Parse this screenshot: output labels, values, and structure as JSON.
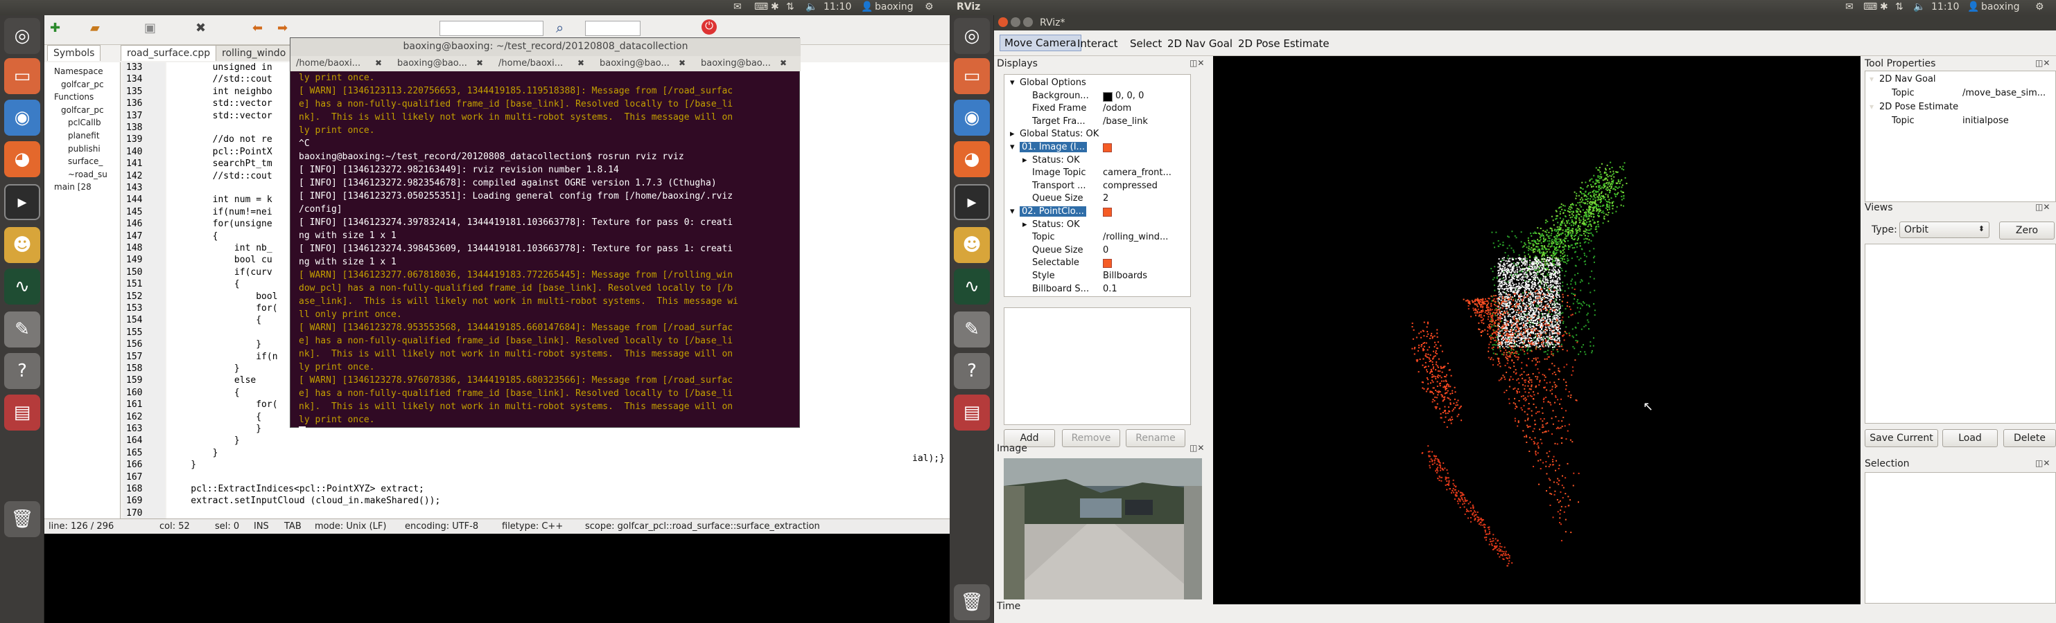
{
  "left_screen": {
    "topbar": {
      "time": "11:10",
      "user": "baoxing"
    },
    "launcher_icons": [
      "ubuntu-icon",
      "folder-icon",
      "chromium-icon",
      "firefox-icon",
      "terminal-icon",
      "game-icon",
      "monitor-icon",
      "editor-icon",
      "help-icon",
      "workspace-icon",
      "trash-icon"
    ],
    "editor": {
      "tabs": [
        "Symbols",
        "road_surface.cpp",
        "rolling_windo"
      ],
      "symbols": [
        "Namespace",
        "golfcar_pc",
        "Functions",
        "golfcar_pc",
        "pclCallb",
        "planefit",
        "publishi",
        "surface_",
        "~road_su",
        "main [28"
      ],
      "line_numbers": [
        "133",
        "134",
        "135",
        "136",
        "137",
        "138",
        "139",
        "140",
        "141",
        "142",
        "143",
        "144",
        "145",
        "146",
        "147",
        "148",
        "149",
        "150",
        "151",
        "152",
        "153",
        "154",
        "155",
        "156",
        "157",
        "158",
        "159",
        "160",
        "161",
        "162",
        "163",
        "164",
        "165",
        "166",
        "167",
        "168",
        "169",
        "170"
      ],
      "code_lines": [
        "        unsigned in",
        "        //std::cout",
        "        int neighbo",
        "        std::vector",
        "        std::vector",
        "",
        "        //do not re",
        "        pcl::PointX",
        "        searchPt_tm",
        "        //std::cout",
        "",
        "        int num = k",
        "        if(num!=nei",
        "        for(unsigne",
        "        {",
        "            int nb_",
        "            bool cu",
        "            if(curv",
        "            {",
        "                bool",
        "                for(",
        "                {",
        "",
        "                }",
        "                if(n",
        "            }",
        "            else",
        "            {",
        "                for(",
        "                {",
        "                }",
        "            }",
        "        }",
        "    }",
        "",
        "    pcl::ExtractIndices<pcl::PointXYZ> extract;",
        "    extract.setInputCloud (cloud_in.makeShared());",
        ""
      ],
      "right_fragment": "ial);}",
      "status": {
        "line": "line: 126 / 296",
        "col": "col: 52",
        "sel": "sel: 0",
        "ins": "INS",
        "tab": "TAB",
        "mode": "mode: Unix (LF)",
        "encoding": "encoding: UTF-8",
        "filetype": "filetype: C++",
        "scope": "scope: golfcar_pcl::road_surface::surface_extraction"
      }
    },
    "terminal": {
      "title": "baoxing@baoxing: ~/test_record/20120808_datacollection",
      "tabs": [
        "/home/baoxi...",
        "baoxing@bao...",
        "/home/baoxi...",
        "baoxing@bao...",
        "baoxing@bao..."
      ],
      "lines": [
        {
          "t": "ly print once.",
          "c": "warn"
        },
        {
          "t": "[ WARN] [1346123113.220756653, 1344419185.119518388]: Message from [/road_surfac",
          "c": "warn"
        },
        {
          "t": "e] has a non-fully-qualified frame_id [base_link]. Resolved locally to [/base_li",
          "c": "warn"
        },
        {
          "t": "nk].  This is will likely not work in multi-robot systems.  This message will on",
          "c": "warn"
        },
        {
          "t": "ly print once.",
          "c": "warn"
        },
        {
          "t": "^C",
          "c": "info"
        },
        {
          "t": "baoxing@baoxing:~/test_record/20120808_datacollection$ rosrun rviz rviz",
          "c": "prompt"
        },
        {
          "t": "[ INFO] [1346123272.982163449]: rviz revision number 1.8.14",
          "c": "info"
        },
        {
          "t": "[ INFO] [1346123272.982354678]: compiled against OGRE version 1.7.3 (Cthugha)",
          "c": "info"
        },
        {
          "t": "[ INFO] [1346123273.050255351]: Loading general config from [/home/baoxing/.rviz",
          "c": "info"
        },
        {
          "t": "/config]",
          "c": "info"
        },
        {
          "t": "[ INFO] [1346123274.397832414, 1344419181.103663778]: Texture for pass 0: creati",
          "c": "info"
        },
        {
          "t": "ng with size 1 x 1",
          "c": "info"
        },
        {
          "t": "[ INFO] [1346123274.398453609, 1344419181.103663778]: Texture for pass 1: creati",
          "c": "info"
        },
        {
          "t": "ng with size 1 x 1",
          "c": "info"
        },
        {
          "t": "[ WARN] [1346123277.067818036, 1344419183.772265445]: Message from [/rolling_win",
          "c": "warn"
        },
        {
          "t": "dow_pcl] has a non-fully-qualified frame_id [base_link]. Resolved locally to [/b",
          "c": "warn"
        },
        {
          "t": "ase_link].  This is will likely not work in multi-robot systems.  This message wi",
          "c": "warn"
        },
        {
          "t": "ll only print once.",
          "c": "warn"
        },
        {
          "t": "[ WARN] [1346123278.953553568, 1344419185.660147684]: Message from [/road_surfac",
          "c": "warn"
        },
        {
          "t": "e] has a non-fully-qualified frame_id [base_link]. Resolved locally to [/base_li",
          "c": "warn"
        },
        {
          "t": "nk].  This is will likely not work in multi-robot systems.  This message will on",
          "c": "warn"
        },
        {
          "t": "ly print once.",
          "c": "warn"
        },
        {
          "t": "[ WARN] [1346123278.976078386, 1344419185.680323566]: Message from [/road_surfac",
          "c": "warn"
        },
        {
          "t": "e] has a non-fully-qualified frame_id [base_link]. Resolved locally to [/base_li",
          "c": "warn"
        },
        {
          "t": "nk].  This is will likely not work in multi-robot systems.  This message will on",
          "c": "warn"
        },
        {
          "t": "ly print once.",
          "c": "warn"
        }
      ]
    }
  },
  "right_screen": {
    "topbar": {
      "app": "RViz",
      "time": "11:10",
      "user": "baoxing"
    },
    "window_title": "RViz*",
    "toolbar": [
      "Move Camera",
      "Interact",
      "Select",
      "2D Nav Goal",
      "2D Pose Estimate"
    ],
    "displays": {
      "header": "Displays",
      "rows": [
        {
          "k": "Global Options",
          "v": "",
          "lvl": 0,
          "arrow": "▾"
        },
        {
          "k": "Backgroun...",
          "v": "0, 0, 0",
          "lvl": 1,
          "sw": true
        },
        {
          "k": "Fixed Frame",
          "v": "/odom",
          "lvl": 1
        },
        {
          "k": "Target Fra...",
          "v": "/base_link",
          "lvl": 1
        },
        {
          "k": "Global Status: OK",
          "v": "",
          "lvl": 0,
          "arrow": "▸"
        },
        {
          "k": "01. Image (I...",
          "v": "",
          "lvl": 0,
          "arrow": "▾",
          "hl": true,
          "chk": true
        },
        {
          "k": "Status: OK",
          "v": "",
          "lvl": 1,
          "arrow": "▸"
        },
        {
          "k": "Image Topic",
          "v": "camera_front...",
          "lvl": 1
        },
        {
          "k": "Transport ...",
          "v": "compressed",
          "lvl": 1
        },
        {
          "k": "Queue Size",
          "v": "2",
          "lvl": 1
        },
        {
          "k": "02. PointClo...",
          "v": "",
          "lvl": 0,
          "arrow": "▾",
          "hl": true,
          "chk": true
        },
        {
          "k": "Status: OK",
          "v": "",
          "lvl": 1,
          "arrow": "▸"
        },
        {
          "k": "Topic",
          "v": "/rolling_wind...",
          "lvl": 1
        },
        {
          "k": "Queue Size",
          "v": "0",
          "lvl": 1
        },
        {
          "k": "Selectable",
          "v": "",
          "lvl": 1,
          "chk": true
        },
        {
          "k": "Style",
          "v": "Billboards",
          "lvl": 1
        },
        {
          "k": "Billboard S...",
          "v": "0.1",
          "lvl": 1
        }
      ],
      "buttons": {
        "add": "Add",
        "remove": "Remove",
        "rename": "Rename"
      }
    },
    "image_panel": {
      "header": "Image"
    },
    "tool_properties": {
      "header": "Tool Properties",
      "rows": [
        {
          "k": "2D Nav Goal",
          "v": "",
          "lvl": 0
        },
        {
          "k": "Topic",
          "v": "/move_base_sim...",
          "lvl": 1
        },
        {
          "k": "2D Pose Estimate",
          "v": "",
          "lvl": 0
        },
        {
          "k": "Topic",
          "v": "initialpose",
          "lvl": 1
        }
      ]
    },
    "views": {
      "header": "Views",
      "type_label": "Type:",
      "type_value": "Orbit",
      "zero": "Zero",
      "save": "Save Current",
      "load": "Load",
      "delete": "Delete"
    },
    "selection": {
      "header": "Selection"
    },
    "time": {
      "header": "Time"
    }
  }
}
